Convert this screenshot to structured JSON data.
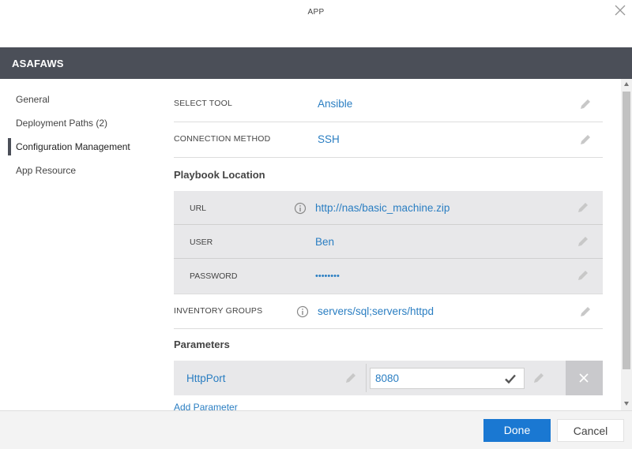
{
  "window": {
    "title": "APP",
    "close_icon": "close-icon"
  },
  "header": {
    "app_name": "ASAFAWS"
  },
  "sidebar": {
    "items": [
      {
        "label": "General",
        "active": false
      },
      {
        "label": "Deployment Paths (2)",
        "active": false
      },
      {
        "label": "Configuration Management",
        "active": true
      },
      {
        "label": "App Resource",
        "active": false
      }
    ]
  },
  "config": {
    "select_tool": {
      "label": "SELECT TOOL",
      "value": "Ansible"
    },
    "connection_method": {
      "label": "CONNECTION METHOD",
      "value": "SSH"
    },
    "playbook": {
      "title": "Playbook Location",
      "url": {
        "label": "URL",
        "value": "http://nas/basic_machine.zip"
      },
      "user": {
        "label": "USER",
        "value": "Ben"
      },
      "password": {
        "label": "PASSWORD",
        "value": "••••••••"
      }
    },
    "inventory_groups": {
      "label": "INVENTORY GROUPS",
      "value": "servers/sql;servers/httpd"
    },
    "parameters": {
      "title": "Parameters",
      "items": [
        {
          "name": "HttpPort",
          "value": "8080"
        }
      ],
      "add_label": "Add Parameter"
    }
  },
  "footer": {
    "done_label": "Done",
    "cancel_label": "Cancel"
  },
  "colors": {
    "accent": "#1a78d2",
    "link": "#2a7ec2",
    "header_bg": "#4b4f58"
  }
}
